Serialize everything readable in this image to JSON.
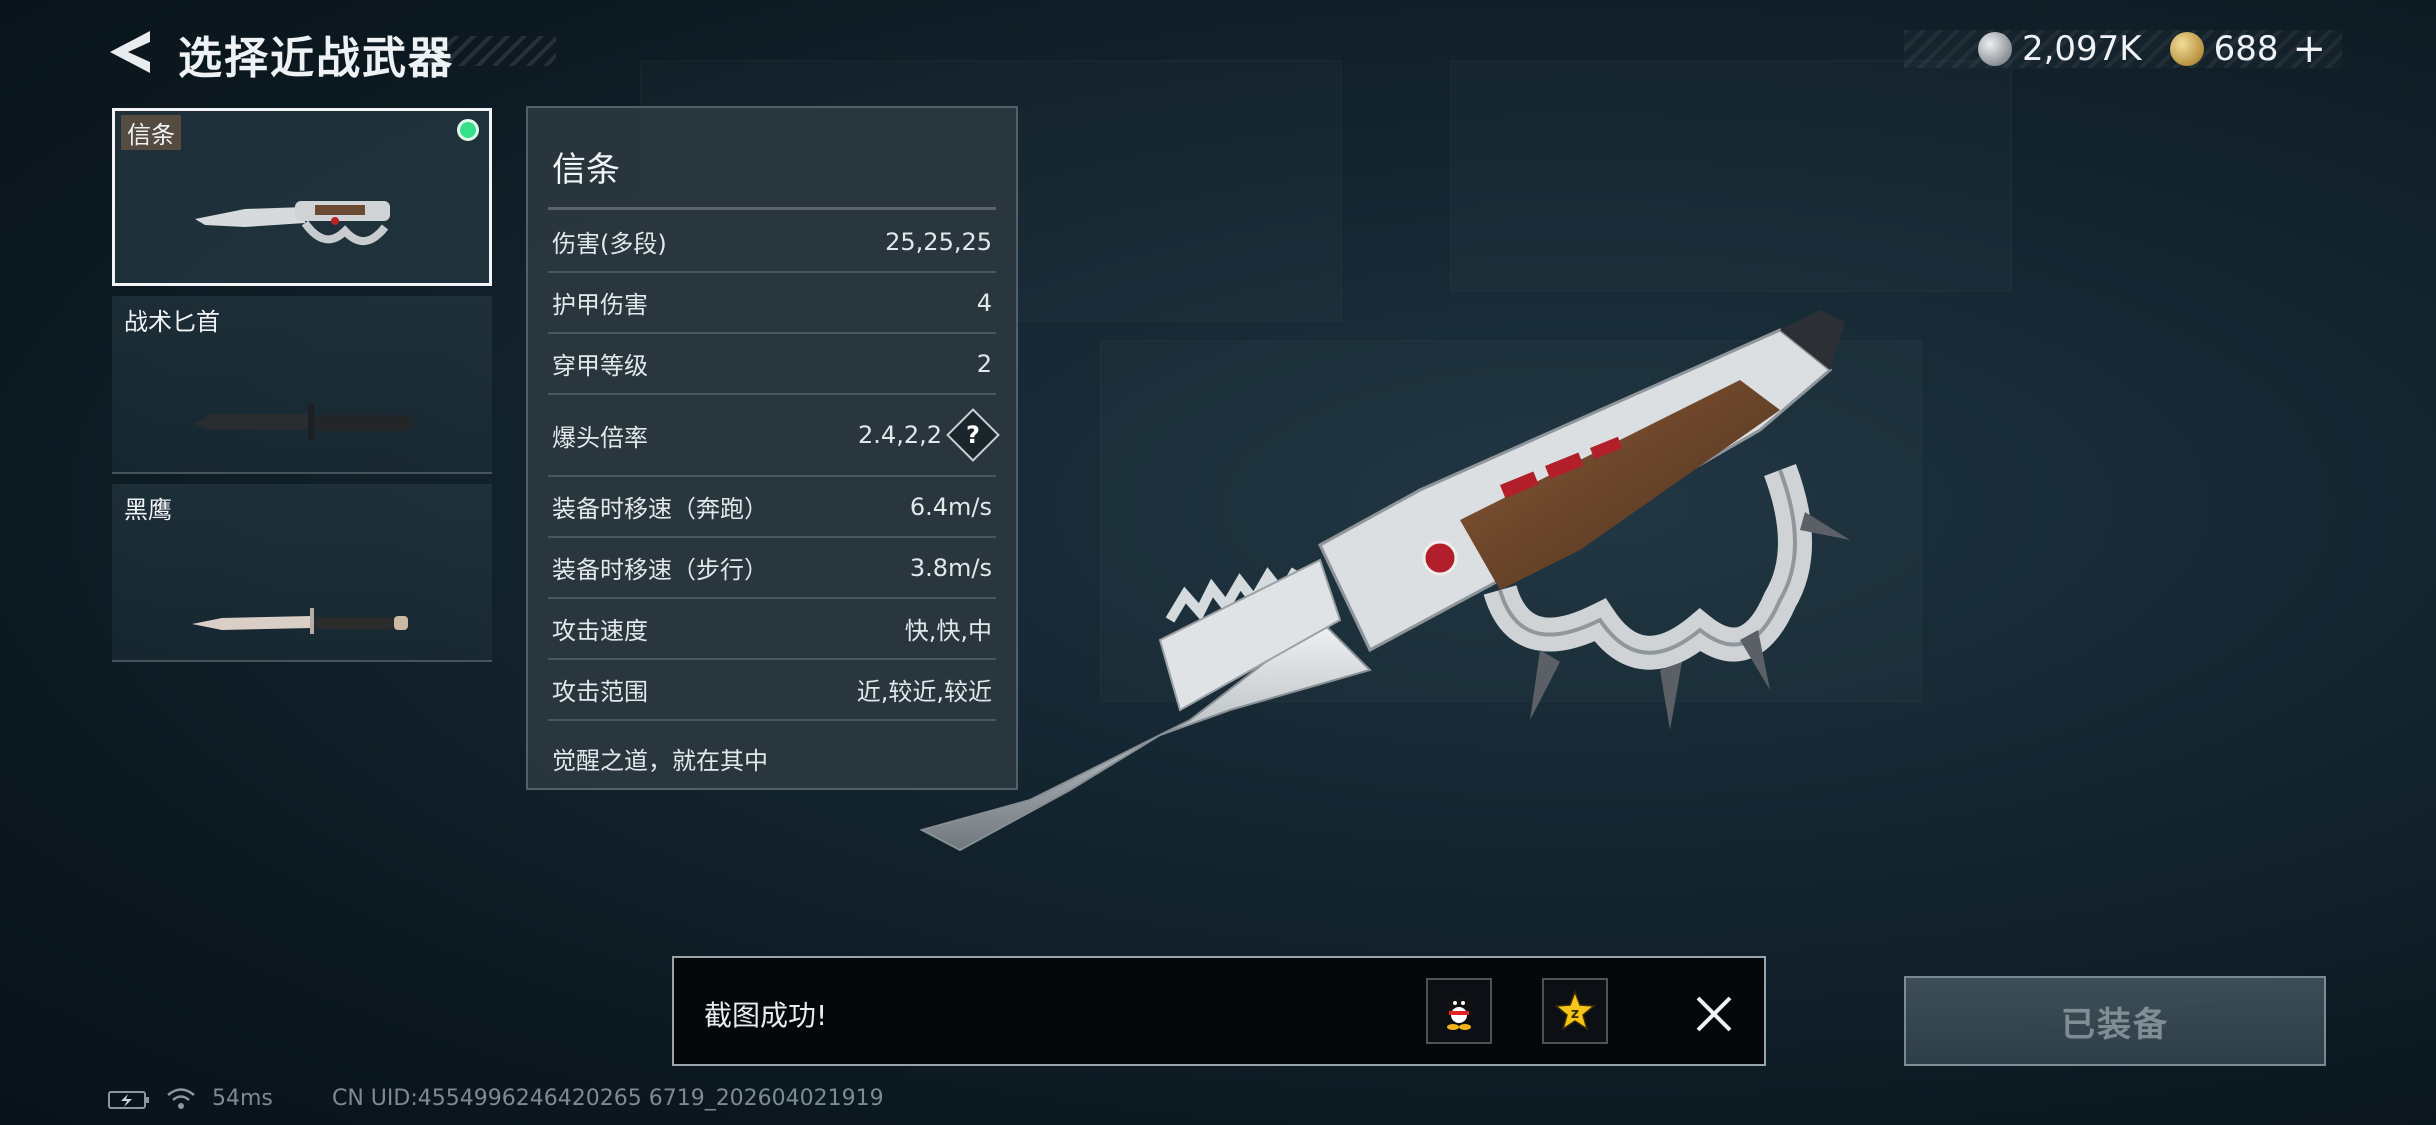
{
  "header": {
    "title": "选择近战武器",
    "currencies": [
      {
        "icon": "silver-coin-icon",
        "value": "2,097K"
      },
      {
        "icon": "gold-coin-icon",
        "value": "688"
      }
    ]
  },
  "weapons": [
    {
      "name": "信条",
      "selected": true,
      "equipped": true
    },
    {
      "name": "战术匕首",
      "selected": false,
      "equipped": false
    },
    {
      "name": "黑鹰",
      "selected": false,
      "equipped": false
    }
  ],
  "stats": {
    "title": "信条",
    "rows": [
      {
        "label": "伤害(多段)",
        "value": "25,25,25"
      },
      {
        "label": "护甲伤害",
        "value": "4"
      },
      {
        "label": "穿甲等级",
        "value": "2"
      },
      {
        "label": "爆头倍率",
        "value": "2.4,2,2"
      },
      {
        "label": "装备时移速（奔跑）",
        "value": "6.4m/s"
      },
      {
        "label": "装备时移速（步行）",
        "value": "3.8m/s"
      },
      {
        "label": "攻击速度",
        "value": "快,快,中"
      },
      {
        "label": "攻击范围",
        "value": "近,较近,较近"
      }
    ],
    "description": "觉醒之道，就在其中",
    "help_label": "?"
  },
  "toast": {
    "message": "截图成功!",
    "share_targets": [
      "qq-icon",
      "qzone-icon"
    ]
  },
  "equip_button": {
    "label": "已装备"
  },
  "status_bar": {
    "ping": "54ms",
    "uid": "CN UID:4554996246420265 6719_202604021919"
  },
  "colors": {
    "equipped_dot": "#34e08a",
    "background": "#142530",
    "panel": "#2a373f"
  }
}
